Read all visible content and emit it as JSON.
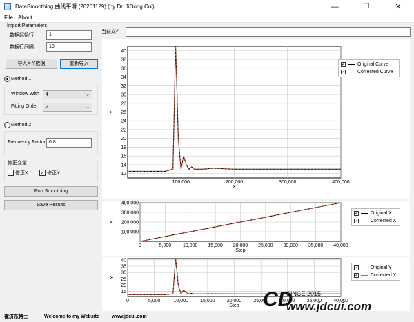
{
  "window": {
    "title": "DataSmoothing 曲线平滑 (20201129) (by Dr. JiDong Cui)",
    "minimize_glyph": "—",
    "maximize_glyph": "☐",
    "close_glyph": "✕"
  },
  "menu": {
    "items": [
      "File",
      "About"
    ]
  },
  "import_params": {
    "group_title": "Import Parameters",
    "start_row_label": "数据起始行",
    "start_row_value": "1",
    "row_interval_label": "数据行间隔",
    "row_interval_value": "10",
    "import_button": "导入X-Y数据",
    "reimport_button": "重新导入"
  },
  "method1": {
    "label": "Method 1",
    "selected": true,
    "window_label": "Window With",
    "window_value": "4",
    "order_label": "Fitting Order",
    "order_value": "2"
  },
  "method2": {
    "label": "Method 2",
    "selected": false,
    "freq_label": "Frequency Factor",
    "freq_value": "0.8"
  },
  "correction": {
    "group_title": "修正变量",
    "x_label": "修正X",
    "x_checked": false,
    "y_label": "修正Y",
    "y_checked": true
  },
  "actions": {
    "run": "Run Smoothing",
    "save": "Save Results"
  },
  "current_file": {
    "label": "当前文件",
    "value": ""
  },
  "charts": {
    "main": {
      "xlabel": "X",
      "ylabel": "Y",
      "xticks": [
        "100,000",
        "200,000",
        "300,000",
        "400,000"
      ],
      "yticks": [
        "12",
        "14",
        "16",
        "18",
        "20",
        "22",
        "24",
        "26",
        "28",
        "30",
        "32",
        "34",
        "36",
        "38",
        "40"
      ],
      "legend": [
        "Original Curve",
        "Corrected Curve"
      ]
    },
    "x": {
      "xlabel": "Step",
      "ylabel": "X",
      "xticks": [
        "0",
        "5,000",
        "10,000",
        "15,000",
        "20,000",
        "25,000",
        "30,000",
        "35,000",
        "40,000"
      ],
      "yticks": [
        "100,000",
        "200,000",
        "300,000",
        "400,000"
      ],
      "legend": [
        "Original X",
        "Corrected X"
      ]
    },
    "y": {
      "xlabel": "Step",
      "ylabel": "Y",
      "xticks": [
        "0",
        "5,000",
        "10,000",
        "15,000",
        "20,000",
        "25,000",
        "30,000",
        "35,000",
        "40,000"
      ],
      "yticks": [
        "15",
        "20",
        "25",
        "30",
        "35",
        "40"
      ],
      "legend": [
        "Original Y",
        "Corrected Y"
      ]
    }
  },
  "chart_data": [
    {
      "type": "line",
      "xlabel": "X",
      "ylabel": "Y",
      "xlim": [
        0,
        400000
      ],
      "ylim": [
        11,
        41
      ],
      "grid": true,
      "legend_position": "right",
      "series": [
        {
          "name": "Original Curve",
          "color": "#000000",
          "x": [
            0,
            40000,
            70000,
            85000,
            88000,
            90000,
            92000,
            95000,
            100000,
            105000,
            110000,
            115000,
            120000,
            125000,
            130000,
            140000,
            160000,
            200000,
            250000,
            300000,
            350000,
            400000
          ],
          "y": [
            12.5,
            12.5,
            12.5,
            13,
            30,
            41,
            33,
            20,
            13,
            16,
            14,
            13,
            13.5,
            13,
            13,
            13,
            13.2,
            13,
            13,
            13,
            13,
            13
          ]
        },
        {
          "name": "Corrected Curve",
          "color": "#e8562a",
          "x": [
            0,
            40000,
            70000,
            85000,
            88000,
            90000,
            92000,
            95000,
            100000,
            105000,
            110000,
            115000,
            120000,
            125000,
            130000,
            140000,
            160000,
            200000,
            250000,
            300000,
            350000,
            400000
          ],
          "y": [
            12.5,
            12.5,
            12.5,
            13,
            30,
            41,
            33,
            20,
            13,
            16,
            14,
            13,
            13.5,
            13,
            13,
            13,
            13.2,
            13,
            13,
            13,
            13,
            13
          ]
        }
      ]
    },
    {
      "type": "line",
      "xlabel": "Step",
      "ylabel": "X",
      "xlim": [
        0,
        40000
      ],
      "ylim": [
        0,
        400000
      ],
      "grid": true,
      "legend_position": "right",
      "series": [
        {
          "name": "Original X",
          "color": "#000000",
          "x": [
            0,
            40000
          ],
          "y": [
            0,
            400000
          ]
        },
        {
          "name": "Corrected X",
          "color": "#e8562a",
          "x": [
            0,
            40000
          ],
          "y": [
            0,
            400000
          ]
        }
      ]
    },
    {
      "type": "line",
      "xlabel": "Step",
      "ylabel": "Y",
      "xlim": [
        0,
        40000
      ],
      "ylim": [
        11,
        41
      ],
      "grid": true,
      "legend_position": "right",
      "series": [
        {
          "name": "Original Y",
          "color": "#000000",
          "x": [
            0,
            4000,
            7000,
            8500,
            8800,
            9000,
            9200,
            9500,
            10000,
            10500,
            11000,
            11500,
            12000,
            12500,
            13000,
            14000,
            16000,
            20000,
            25000,
            30000,
            35000,
            40000
          ],
          "y": [
            12.5,
            12.5,
            12.5,
            13,
            30,
            41,
            33,
            20,
            13,
            16,
            14,
            13,
            13.5,
            13,
            13,
            13,
            13.2,
            13,
            13,
            13,
            13,
            13
          ]
        },
        {
          "name": "Corrected Y",
          "color": "#e8562a",
          "x": [
            0,
            4000,
            7000,
            8500,
            8800,
            9000,
            9200,
            9500,
            10000,
            10500,
            11000,
            11500,
            12000,
            12500,
            13000,
            14000,
            16000,
            20000,
            25000,
            30000,
            35000,
            40000
          ],
          "y": [
            12.5,
            12.5,
            12.5,
            13,
            30,
            41,
            33,
            20,
            13,
            16,
            14,
            13,
            13.5,
            13,
            13,
            13,
            13.2,
            13,
            13,
            13,
            13,
            13
          ]
        }
      ]
    }
  ],
  "status": {
    "author": "崔济东博士",
    "welcome": "Welcome to my Website",
    "site": "www.jdcui.com"
  },
  "watermark": {
    "since": "SINCE 2015",
    "url": "www.jdcui.com"
  },
  "colors": {
    "accent": "#0078d7",
    "original": "#000000",
    "corrected": "#e8562a"
  }
}
